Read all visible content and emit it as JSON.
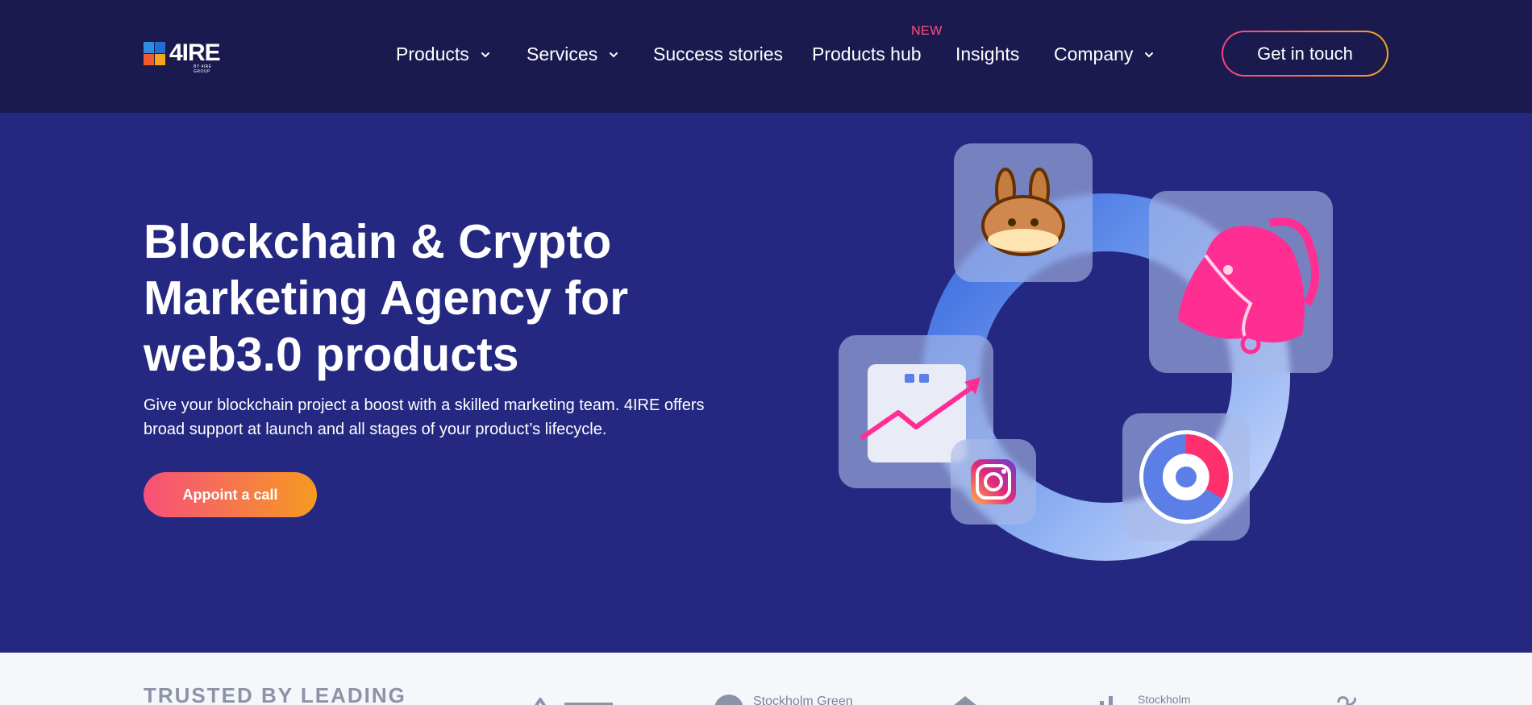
{
  "header": {
    "logo": {
      "text": "4IRE",
      "subtext": "BY 4IRE GROUP",
      "colors": [
        "#2e8fe0",
        "#1f6fd1",
        "#f15a2a",
        "#f7a31b"
      ]
    },
    "nav": [
      {
        "label": "Products",
        "has_dropdown": true
      },
      {
        "label": "Services",
        "has_dropdown": true
      },
      {
        "label": "Success stories",
        "has_dropdown": false
      },
      {
        "label": "Products hub",
        "has_dropdown": false,
        "badge": "NEW"
      },
      {
        "label": "Insights",
        "has_dropdown": false
      },
      {
        "label": "Company",
        "has_dropdown": true
      }
    ],
    "cta_label": "Get in touch"
  },
  "hero": {
    "title": "Blockchain & Crypto Marketing Agency for web3.0 products",
    "description": "Give your blockchain project a boost with a skilled marketing team. 4IRE offers broad support at launch and all stages of your product’s lifecycle.",
    "button_label": "Appoint a call",
    "illustration_icons": [
      "pancakeswap-bunny-icon",
      "uniswap-unicorn-icon",
      "growth-chart-icon",
      "instagram-icon",
      "donut-chart-icon"
    ]
  },
  "trusted": {
    "title": "TRUSTED BY LEADING",
    "partners": [
      "Stockholm Green",
      "Stockholm"
    ]
  },
  "colors": {
    "header_bg": "#1b1a4f",
    "hero_bg": "#242880",
    "accent_pink": "#f7417e",
    "accent_orange": "#f5a623",
    "trusted_bg": "#f5f7fb"
  }
}
